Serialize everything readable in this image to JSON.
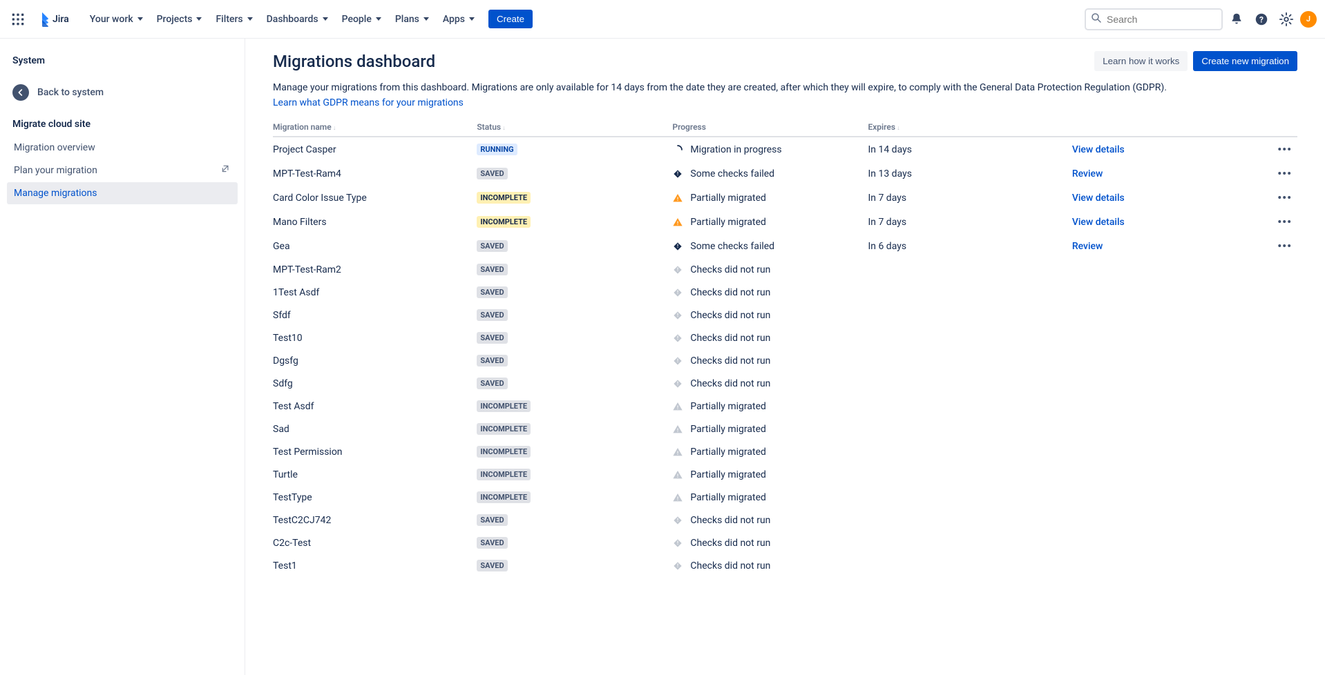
{
  "topnav": {
    "product": "Jira",
    "items": [
      "Your work",
      "Projects",
      "Filters",
      "Dashboards",
      "People",
      "Plans",
      "Apps"
    ],
    "create": "Create",
    "search_placeholder": "Search",
    "avatar_initial": "J"
  },
  "sidebar": {
    "title": "System",
    "back": "Back to system",
    "section": "Migrate cloud site",
    "items": [
      {
        "label": "Migration overview",
        "ext": false,
        "active": false
      },
      {
        "label": "Plan your migration",
        "ext": true,
        "active": false
      },
      {
        "label": "Manage migrations",
        "ext": false,
        "active": true
      }
    ]
  },
  "page": {
    "title": "Migrations dashboard",
    "learn_btn": "Learn how it works",
    "create_btn": "Create new migration",
    "desc": "Manage your migrations from this dashboard. Migrations are only available for 14 days from the date they are created, after which they will expire, to comply with the General Data Protection Regulation (GDPR).",
    "desc_link": "Learn what GDPR means for your migrations"
  },
  "columns": {
    "name": "Migration name",
    "status": "Status",
    "progress": "Progress",
    "expires": "Expires"
  },
  "status_labels": {
    "running": "RUNNING",
    "saved": "SAVED",
    "incomplete": "INCOMPLETE"
  },
  "progress_labels": {
    "in_progress": "Migration in progress",
    "checks_failed": "Some checks failed",
    "partial": "Partially migrated",
    "not_run": "Checks did not run"
  },
  "actions": {
    "view": "View details",
    "review": "Review"
  },
  "rows": [
    {
      "name": "Project Casper",
      "status": "running",
      "badge_style": "running",
      "progress": "in_progress",
      "pi": "spinner",
      "expires": "In 14 days",
      "action": "view",
      "menu": true
    },
    {
      "name": "MPT-Test-Ram4",
      "status": "saved",
      "badge_style": "saved",
      "progress": "checks_failed",
      "pi": "diamond-dark",
      "expires": "In 13 days",
      "action": "review",
      "menu": true
    },
    {
      "name": "Card Color Issue Type",
      "status": "incomplete",
      "badge_style": "incomplete-y",
      "progress": "partial",
      "pi": "warn-orange",
      "expires": "In 7 days",
      "action": "view",
      "menu": true
    },
    {
      "name": "Mano Filters",
      "status": "incomplete",
      "badge_style": "incomplete-y",
      "progress": "partial",
      "pi": "warn-orange",
      "expires": "In 7 days",
      "action": "view",
      "menu": true
    },
    {
      "name": "Gea",
      "status": "saved",
      "badge_style": "saved",
      "progress": "checks_failed",
      "pi": "diamond-dark",
      "expires": "In 6 days",
      "action": "review",
      "menu": true
    },
    {
      "name": "MPT-Test-Ram2",
      "status": "saved",
      "badge_style": "saved",
      "progress": "not_run",
      "pi": "diamond-grey",
      "expires": "",
      "action": "",
      "menu": false
    },
    {
      "name": "1Test Asdf",
      "status": "saved",
      "badge_style": "saved",
      "progress": "not_run",
      "pi": "diamond-grey",
      "expires": "",
      "action": "",
      "menu": false
    },
    {
      "name": "Sfdf",
      "status": "saved",
      "badge_style": "saved",
      "progress": "not_run",
      "pi": "diamond-grey",
      "expires": "",
      "action": "",
      "menu": false
    },
    {
      "name": "Test10",
      "status": "saved",
      "badge_style": "saved",
      "progress": "not_run",
      "pi": "diamond-grey",
      "expires": "",
      "action": "",
      "menu": false
    },
    {
      "name": "Dgsfg",
      "status": "saved",
      "badge_style": "saved",
      "progress": "not_run",
      "pi": "diamond-grey",
      "expires": "",
      "action": "",
      "menu": false
    },
    {
      "name": "Sdfg",
      "status": "saved",
      "badge_style": "saved",
      "progress": "not_run",
      "pi": "diamond-grey",
      "expires": "",
      "action": "",
      "menu": false
    },
    {
      "name": "Test Asdf",
      "status": "incomplete",
      "badge_style": "incomplete-g",
      "progress": "partial",
      "pi": "warn-grey",
      "expires": "",
      "action": "",
      "menu": false
    },
    {
      "name": "Sad",
      "status": "incomplete",
      "badge_style": "incomplete-g",
      "progress": "partial",
      "pi": "warn-grey",
      "expires": "",
      "action": "",
      "menu": false
    },
    {
      "name": "Test Permission",
      "status": "incomplete",
      "badge_style": "incomplete-g",
      "progress": "partial",
      "pi": "warn-grey",
      "expires": "",
      "action": "",
      "menu": false
    },
    {
      "name": "Turtle",
      "status": "incomplete",
      "badge_style": "incomplete-g",
      "progress": "partial",
      "pi": "warn-grey",
      "expires": "",
      "action": "",
      "menu": false
    },
    {
      "name": "TestType",
      "status": "incomplete",
      "badge_style": "incomplete-g",
      "progress": "partial",
      "pi": "warn-grey",
      "expires": "",
      "action": "",
      "menu": false
    },
    {
      "name": "TestC2CJ742",
      "status": "saved",
      "badge_style": "saved",
      "progress": "not_run",
      "pi": "diamond-grey",
      "expires": "",
      "action": "",
      "menu": false
    },
    {
      "name": "C2c-Test",
      "status": "saved",
      "badge_style": "saved",
      "progress": "not_run",
      "pi": "diamond-grey",
      "expires": "",
      "action": "",
      "menu": false
    },
    {
      "name": "Test1",
      "status": "saved",
      "badge_style": "saved",
      "progress": "not_run",
      "pi": "diamond-grey",
      "expires": "",
      "action": "",
      "menu": false
    }
  ]
}
